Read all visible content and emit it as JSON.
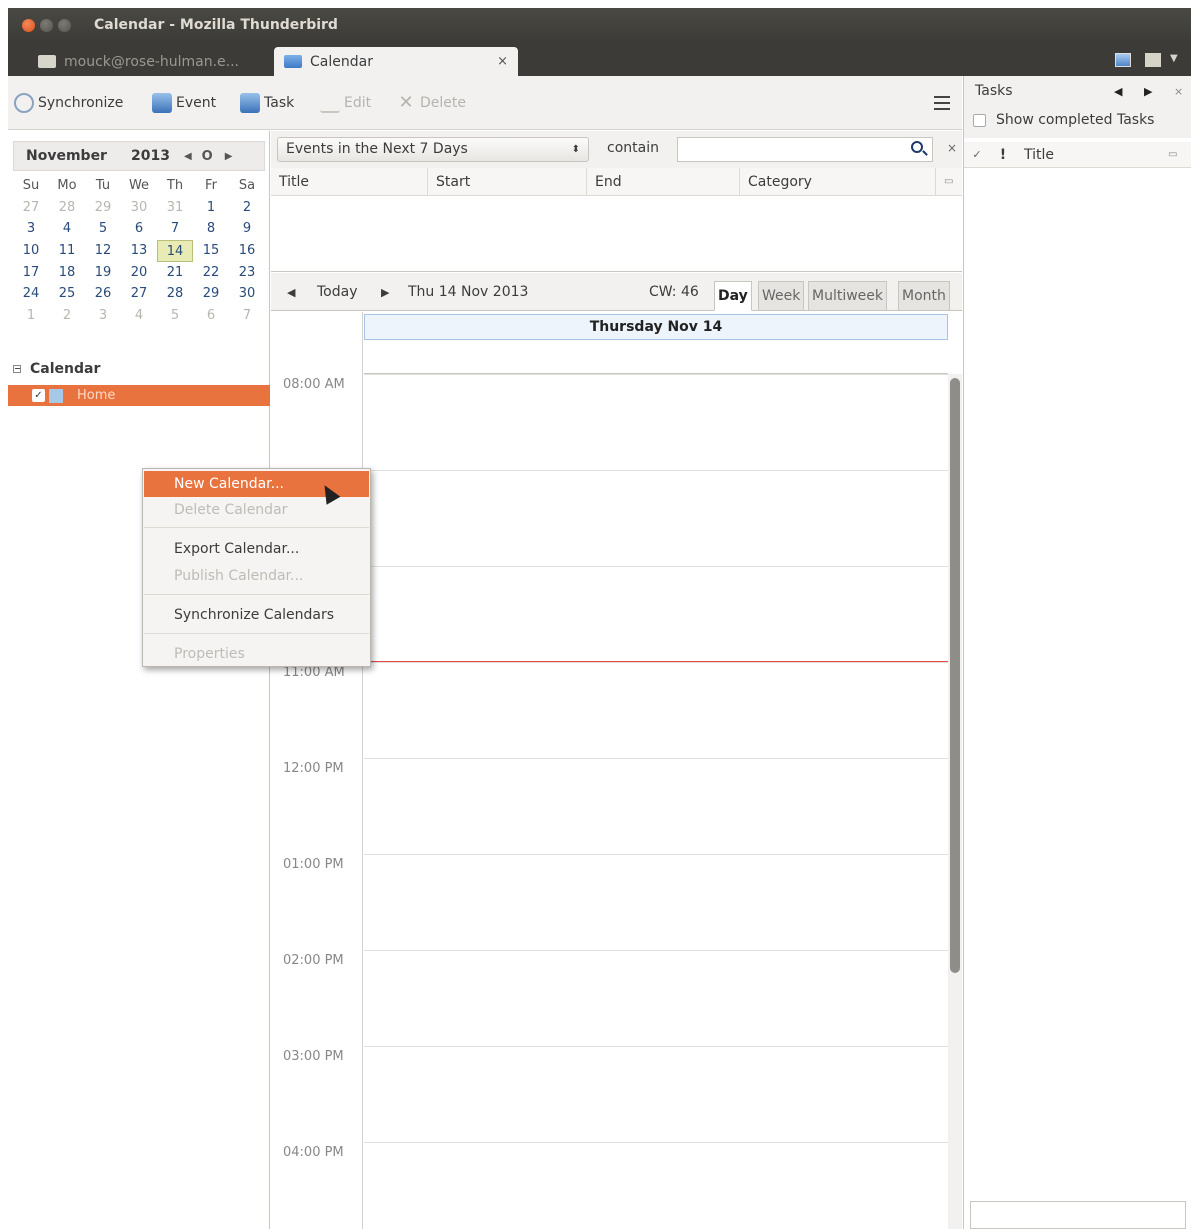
{
  "window": {
    "title": "Calendar - Mozilla Thunderbird"
  },
  "tabs": [
    {
      "label": "mouck@rose-hulman.e..."
    },
    {
      "label": "Calendar",
      "close": "×"
    }
  ],
  "toolbar": {
    "synchronize": "Synchronize",
    "event": "Event",
    "task": "Task",
    "edit": "Edit",
    "delete": "Delete"
  },
  "minimonth": {
    "month": "November",
    "year": "2013",
    "prev": "◀",
    "today": "O",
    "next": "▶",
    "weekdays": [
      "Su",
      "Mo",
      "Tu",
      "We",
      "Th",
      "Fr",
      "Sa"
    ],
    "days": [
      [
        "27",
        "28",
        "29",
        "30",
        "31",
        "1",
        "2"
      ],
      [
        "3",
        "4",
        "5",
        "6",
        "7",
        "8",
        "9"
      ],
      [
        "10",
        "11",
        "12",
        "13",
        "14",
        "15",
        "16"
      ],
      [
        "17",
        "18",
        "19",
        "20",
        "21",
        "22",
        "23"
      ],
      [
        "24",
        "25",
        "26",
        "27",
        "28",
        "29",
        "30"
      ],
      [
        "1",
        "2",
        "3",
        "4",
        "5",
        "6",
        "7"
      ]
    ],
    "selected_day": "14"
  },
  "calendars": {
    "heading": "Calendar",
    "items": [
      {
        "name": "Home",
        "checked": true
      }
    ]
  },
  "filter": {
    "selected": "Events in the Next 7 Days",
    "contain_label": "contain",
    "search_value": "",
    "close": "×"
  },
  "list_columns": [
    "Title",
    "Start",
    "End",
    "Category"
  ],
  "nav": {
    "prev": "◀",
    "today": "Today",
    "next": "▶",
    "date": "Thu 14 Nov 2013",
    "cw": "CW: 46"
  },
  "views": [
    "Day",
    "Week",
    "Multiweek",
    "Month"
  ],
  "dayview": {
    "header": "Thursday Nov 14",
    "hours": [
      "08:00 AM",
      "11:00 AM",
      "12:00 PM",
      "01:00 PM",
      "02:00 PM",
      "03:00 PM",
      "04:00 PM"
    ]
  },
  "tasks": {
    "title": "Tasks",
    "show_completed": "Show completed Tasks",
    "columns": [
      "Title"
    ],
    "priority_symbol": "!",
    "check_symbol": "✓"
  },
  "context_menu": {
    "items": [
      {
        "label": "New Calendar...",
        "enabled": true,
        "hovered": true
      },
      {
        "label": "Delete Calendar",
        "enabled": false
      },
      {
        "label": "Export Calendar...",
        "enabled": true
      },
      {
        "label": "Publish Calendar...",
        "enabled": false
      },
      {
        "label": "Synchronize Calendars",
        "enabled": true
      },
      {
        "label": "Properties",
        "enabled": false
      }
    ]
  },
  "colors": {
    "accent": "#e8733e",
    "title_bar": "#3c3b37",
    "today_highlight": "#e8ecb4",
    "now_line": "#e8474b"
  }
}
